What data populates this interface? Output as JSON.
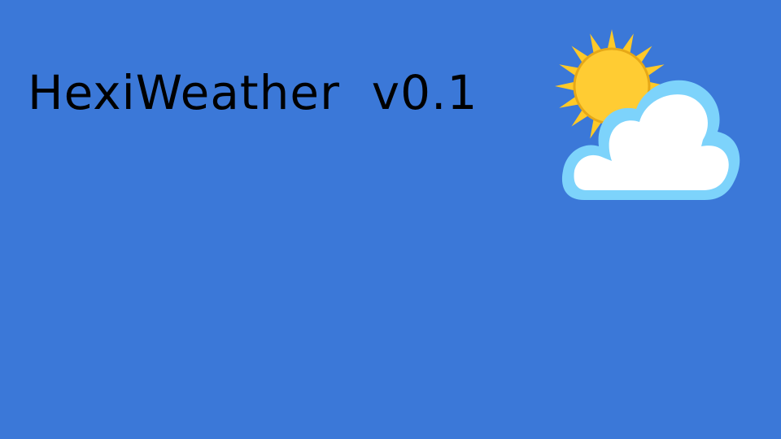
{
  "app": {
    "title": "HexiWeather  v0.1"
  },
  "weather": {
    "icon": "partly-cloudy-icon",
    "sun_color": "#ffcc33",
    "sun_ray_color": "#ffc928",
    "sun_outline": "#e6a817",
    "cloud_fill": "#ffffff",
    "cloud_outline": "#7dd3fb"
  },
  "colors": {
    "background": "#3b78d8",
    "title_text": "#000000"
  }
}
